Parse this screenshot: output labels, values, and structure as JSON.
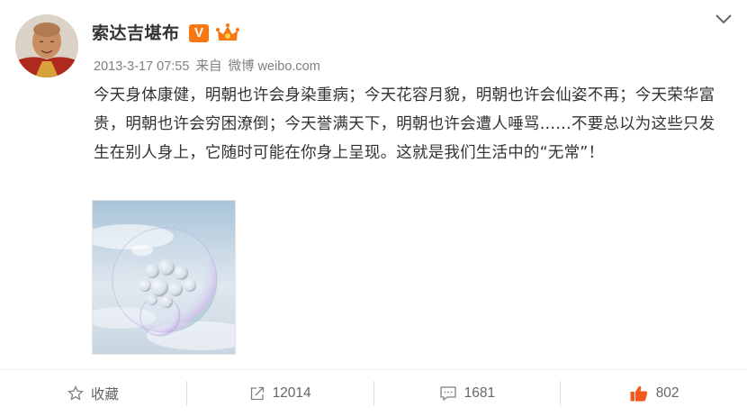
{
  "post": {
    "author": "索达吉堪布",
    "badge": "V",
    "timestamp": "2013-3-17 07:55",
    "source_prefix": "来自",
    "source": "微博 weibo.com",
    "text": "今天身体康健，明朝也许会身染重病；今天花容月貌，明朝也许会仙姿不再；今天荣华富贵，明朝也许会穷困潦倒；今天誉满天下，明朝也许会遭人唾骂……不要总以为这些只发生在别人身上，它随时可能在你身上呈现。这就是我们生活中的“无常”！"
  },
  "icons": {
    "expand": "chevron-down-icon",
    "verified": "verified-v-badge",
    "member": "member-crown-icon",
    "favorite": "star-icon",
    "repost": "repost-icon",
    "comment": "comment-icon",
    "like": "thumbs-up-icon"
  },
  "colors": {
    "badge": "#f77812",
    "like": "#f25b1f",
    "text": "#333333",
    "muted": "#808080"
  },
  "toolbar": {
    "favorite_label": "收藏",
    "repost_count": "12014",
    "comment_count": "1681",
    "like_count": "802"
  }
}
